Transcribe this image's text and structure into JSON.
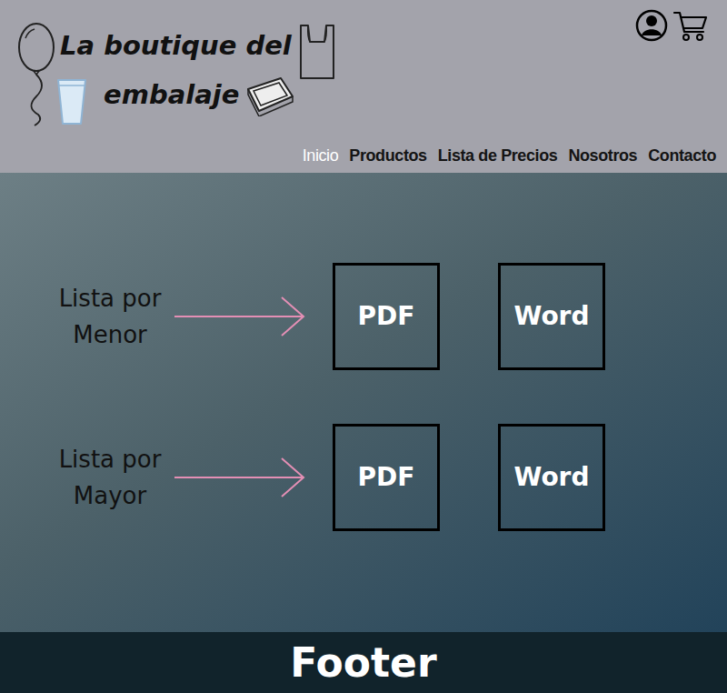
{
  "brand": {
    "line1": "La boutique del",
    "line2": "embalaje"
  },
  "nav": [
    {
      "label": "Inicio",
      "selected": true
    },
    {
      "label": "Productos",
      "selected": false
    },
    {
      "label": "Lista de Precios",
      "selected": false
    },
    {
      "label": "Nosotros",
      "selected": false
    },
    {
      "label": "Contacto",
      "selected": false
    }
  ],
  "lists": [
    {
      "label": "Lista por Menor",
      "files": [
        "PDF",
        "Word"
      ]
    },
    {
      "label": "Lista por Mayor",
      "files": [
        "PDF",
        "Word"
      ]
    }
  ],
  "footer": "Footer"
}
